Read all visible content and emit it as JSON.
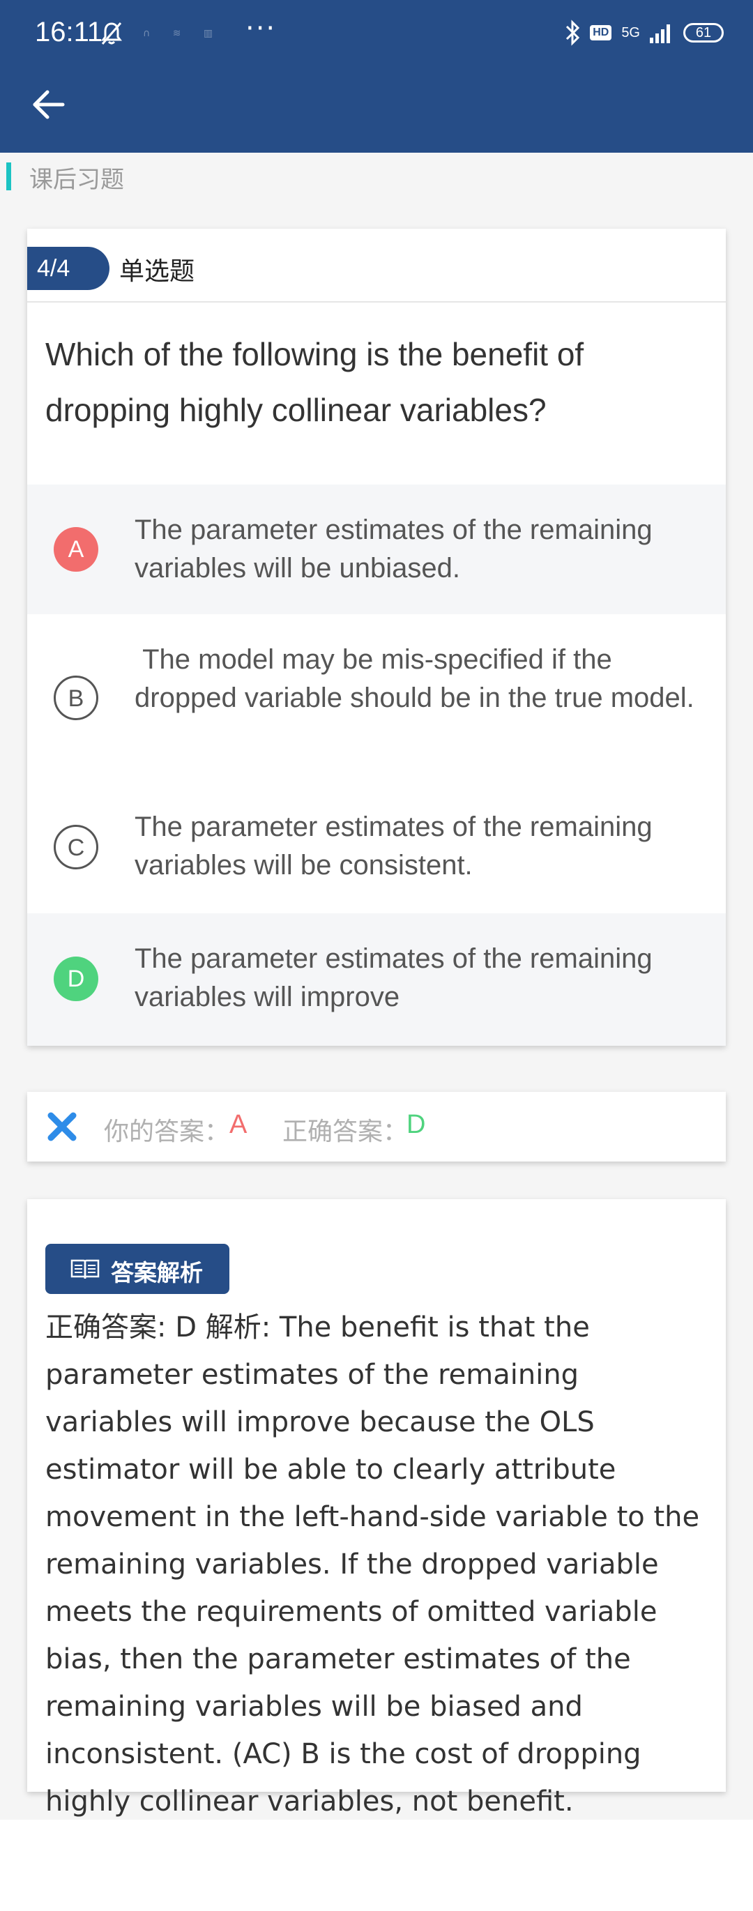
{
  "status_bar": {
    "time": "16:11",
    "dots": "∩ ≋ ▥",
    "more": "···",
    "hd": "HD",
    "network": "5G",
    "battery": "61"
  },
  "section": {
    "title": "课后习题"
  },
  "question": {
    "number": "4/4",
    "type": "单选题",
    "text": "Which of the following is the benefit of dropping highly collinear variables?",
    "options": [
      {
        "letter": "A",
        "text": "The parameter estimates of the remaining variables will be unbiased.",
        "state": "wrong"
      },
      {
        "letter": "B",
        "text": " The model may be mis-specified if the dropped variable should be in the true model.",
        "state": "plain"
      },
      {
        "letter": "C",
        "text": "The parameter estimates of the remaining variables will be consistent.",
        "state": "plain"
      },
      {
        "letter": "D",
        "text": "The parameter estimates of the remaining variables will improve",
        "state": "correct"
      }
    ]
  },
  "answer": {
    "your_label": "你的答案：",
    "your_value": "A",
    "correct_label": "正确答案：",
    "correct_value": "D"
  },
  "explanation": {
    "badge": "答案解析",
    "text": "正确答案: D 解析: The benefit is that the parameter estimates of the remaining variables will improve because the OLS estimator will be able to clearly attribute movement in the left-hand-side variable to the remaining variables. If the dropped variable meets the requirements of omitted variable bias, then the parameter estimates of the remaining variables will be biased and inconsistent. (AC) B is the cost of dropping highly collinear variables, not benefit."
  },
  "colors": {
    "header": "#264d87",
    "wrong": "#f26d6d",
    "correct": "#4fd37e",
    "wrong_icon": "#2e8ce8",
    "section_accent": "#1cc3c3"
  },
  "icons": [
    "back-arrow-icon",
    "mute-bell-icon",
    "bluetooth-icon",
    "signal-icon",
    "battery-icon",
    "x-icon",
    "book-icon"
  ]
}
